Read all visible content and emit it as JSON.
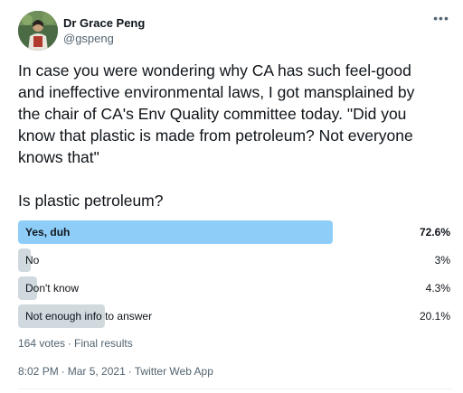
{
  "author": {
    "display_name": "Dr Grace Peng",
    "handle": "@gspeng"
  },
  "tweet": {
    "text": "In case you were wondering why CA has such feel-good\nand ineffective environmental laws, I got mansplained by\nthe chair of CA's Env Quality committee today. \"Did you\nknow that plastic is made from petroleum? Not everyone\nknows that\"",
    "question": "Is plastic petroleum?"
  },
  "poll": {
    "options": [
      {
        "label": "Yes, duh",
        "percent_text": "72.6%",
        "percent": 72.6,
        "winner": true
      },
      {
        "label": "No",
        "percent_text": "3%",
        "percent": 3,
        "winner": false
      },
      {
        "label": "Don't know",
        "percent_text": "4.3%",
        "percent": 4.3,
        "winner": false
      },
      {
        "label": "Not enough info to answer",
        "percent_text": "20.1%",
        "percent": 20.1,
        "winner": false
      }
    ],
    "votes": "164 votes",
    "status": "Final results"
  },
  "meta": {
    "time": "8:02 PM",
    "date": "Mar 5, 2021",
    "client": "Twitter Web App"
  },
  "icons": {
    "more": "more-options-icon",
    "avatar": "profile-photo"
  },
  "colors": {
    "winner_bar": "#8ecdf8",
    "other_bar": "#cfd9de",
    "secondary_text": "#536471"
  }
}
